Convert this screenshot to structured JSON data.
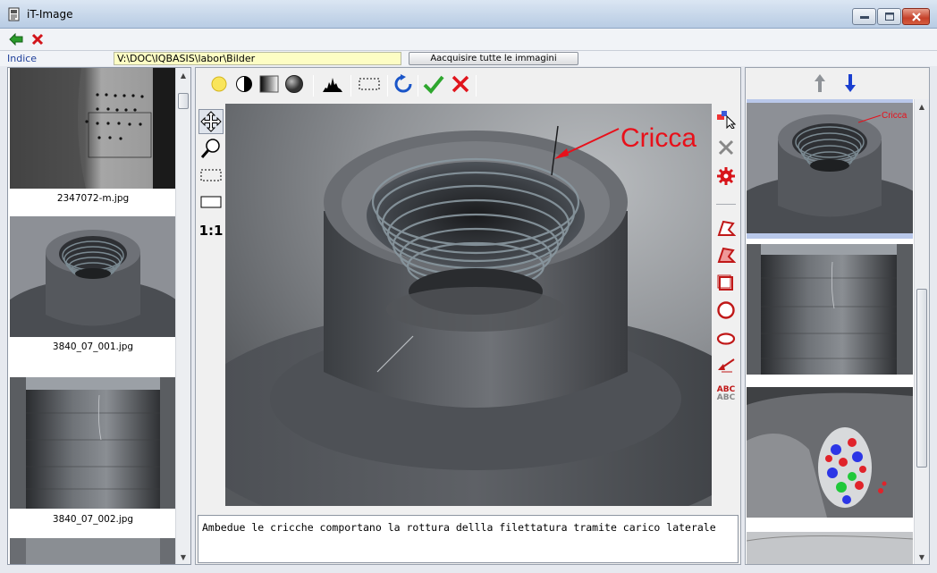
{
  "window": {
    "title": "iT-Image"
  },
  "toolbar": {
    "back_tooltip": "",
    "close_tooltip": ""
  },
  "pathbar": {
    "label": "Indice",
    "path_value": "V:\\DOC\\IQBASIS\\labor\\Bilder",
    "acquire_label": "Aacquisire tutte le immagini"
  },
  "left_thumbnails": [
    {
      "caption": "2347072-m.jpg"
    },
    {
      "caption": "3840_07_001.jpg"
    },
    {
      "caption": "3840_07_002.jpg"
    },
    {
      "caption": ""
    }
  ],
  "main_image": {
    "annotation": "Cricca"
  },
  "left_tools": {
    "scale_label": "1:1"
  },
  "right_tools": {
    "text_tool_label": "ABC"
  },
  "comment": {
    "text": "Ambedue le cricche comportano la rottura dellla filettatura tramite carico laterale"
  },
  "right_panel": {
    "items": [
      {
        "annotation": "Cricca",
        "selected": true
      },
      {
        "annotation": "",
        "selected": false
      },
      {
        "annotation": "",
        "selected": false
      },
      {
        "annotation": "",
        "selected": false
      }
    ]
  },
  "colors": {
    "accent_blue": "#1f3f9a",
    "path_bg": "#fdfdc4",
    "annotation_red": "#e8101a",
    "selection": "#b9c8ea"
  }
}
